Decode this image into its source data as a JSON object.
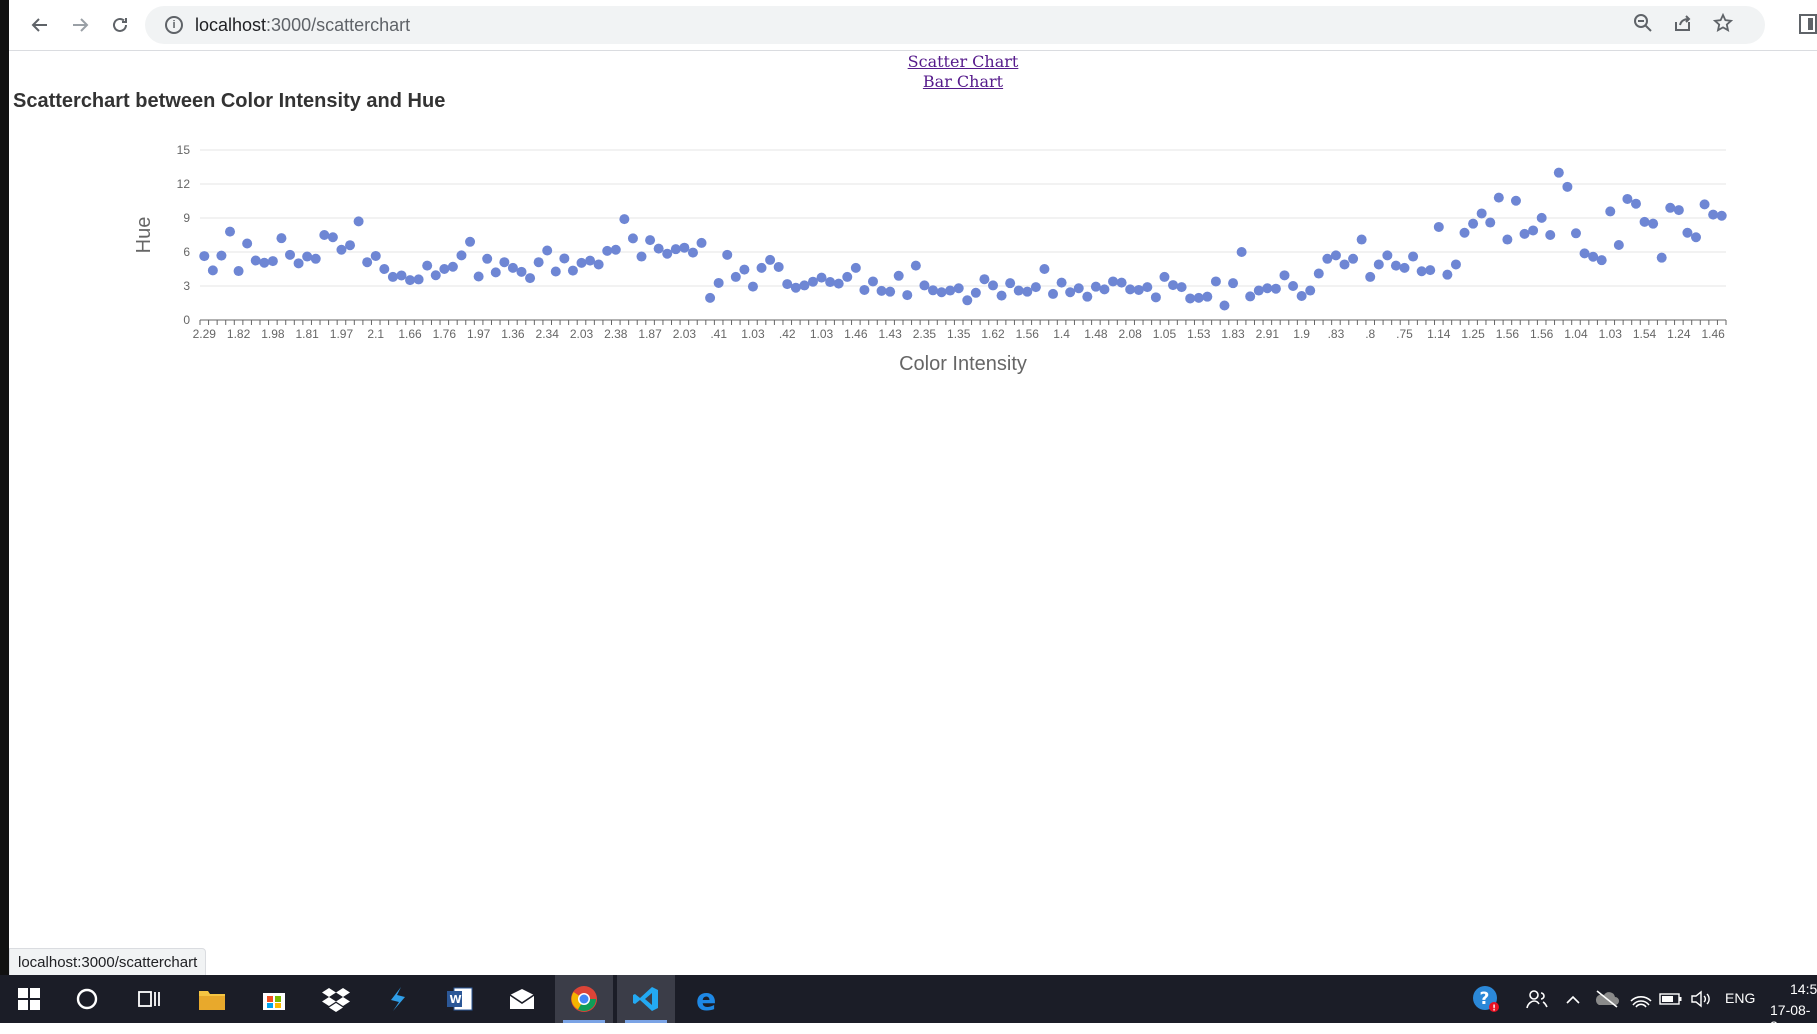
{
  "browser": {
    "url_host": "localhost",
    "url_path": ":3000/scatterchart"
  },
  "nav_links": [
    "Scatter Chart",
    "Bar Chart"
  ],
  "page_title": "Scatterchart between Color Intensity and Hue",
  "status_url": "localhost:3000/scatterchart",
  "chart_data": {
    "type": "scatter",
    "title": "",
    "xlabel": "Color Intensity",
    "ylabel": "Hue",
    "ylim": [
      0,
      15
    ],
    "yticks": [
      0,
      3,
      6,
      9,
      12,
      15
    ],
    "x_tick_labels": [
      "2.29",
      "1.82",
      "1.98",
      "1.81",
      "1.97",
      "2.1",
      "1.66",
      "1.76",
      "1.97",
      "1.36",
      "2.34",
      "2.03",
      "2.38",
      "1.87",
      "2.03",
      ".41",
      "1.03",
      ".42",
      "1.03",
      "1.46",
      "1.43",
      "2.35",
      "1.35",
      "1.62",
      "1.56",
      "1.4",
      "1.48",
      "2.08",
      "1.05",
      "1.53",
      "1.83",
      "2.91",
      "1.9",
      ".83",
      ".8",
      ".75",
      "1.14",
      "1.25",
      "1.56",
      "1.56",
      "1.04",
      "1.03",
      "1.54",
      "1.24",
      "1.46"
    ],
    "grid": true,
    "color": "#6e86d4",
    "y": [
      5.64,
      4.38,
      5.68,
      7.8,
      4.32,
      6.75,
      5.25,
      5.05,
      5.2,
      7.22,
      5.75,
      5.0,
      5.6,
      5.4,
      7.5,
      7.3,
      6.2,
      6.6,
      8.7,
      5.1,
      5.65,
      4.5,
      3.8,
      3.93,
      3.52,
      3.58,
      4.8,
      3.95,
      4.5,
      4.7,
      5.7,
      6.9,
      3.84,
      5.4,
      4.2,
      5.1,
      4.6,
      4.25,
      3.7,
      5.1,
      6.13,
      4.28,
      5.43,
      4.36,
      5.04,
      5.24,
      4.9,
      6.1,
      6.2,
      8.9,
      7.2,
      5.6,
      7.05,
      6.3,
      5.85,
      6.25,
      6.38,
      5.95,
      6.8,
      1.95,
      3.27,
      5.75,
      3.8,
      4.45,
      2.95,
      4.6,
      5.3,
      4.68,
      3.17,
      2.85,
      3.05,
      3.38,
      3.74,
      3.35,
      3.21,
      3.8,
      4.6,
      2.65,
      3.4,
      2.57,
      2.5,
      3.9,
      2.2,
      4.8,
      3.05,
      2.62,
      2.45,
      2.6,
      2.8,
      1.74,
      2.4,
      3.6,
      3.05,
      2.15,
      3.25,
      2.6,
      2.5,
      2.9,
      4.5,
      2.3,
      3.3,
      2.45,
      2.8,
      2.06,
      2.94,
      2.7,
      3.4,
      3.3,
      2.7,
      2.65,
      2.9,
      2.0,
      3.8,
      3.08,
      2.9,
      1.9,
      1.95,
      2.06,
      3.4,
      1.28,
      3.25,
      6.0,
      2.08,
      2.6,
      2.8,
      2.76,
      3.94,
      3.0,
      2.12,
      2.6,
      4.1,
      5.4,
      5.7,
      4.9,
      5.4,
      7.1,
      3.8,
      4.9,
      5.7,
      4.8,
      4.6,
      5.6,
      4.3,
      4.4,
      8.21,
      4.0,
      4.9,
      7.7,
      8.5,
      9.4,
      8.6,
      10.8,
      7.1,
      10.52,
      7.6,
      7.9,
      9.01,
      7.5,
      13.0,
      11.75,
      7.65,
      5.88,
      5.58,
      5.28,
      9.58,
      6.62,
      10.68,
      10.26,
      8.66,
      8.5,
      5.5,
      9.899,
      9.7,
      7.7,
      7.3,
      10.2,
      9.3,
      9.2
    ]
  }
}
